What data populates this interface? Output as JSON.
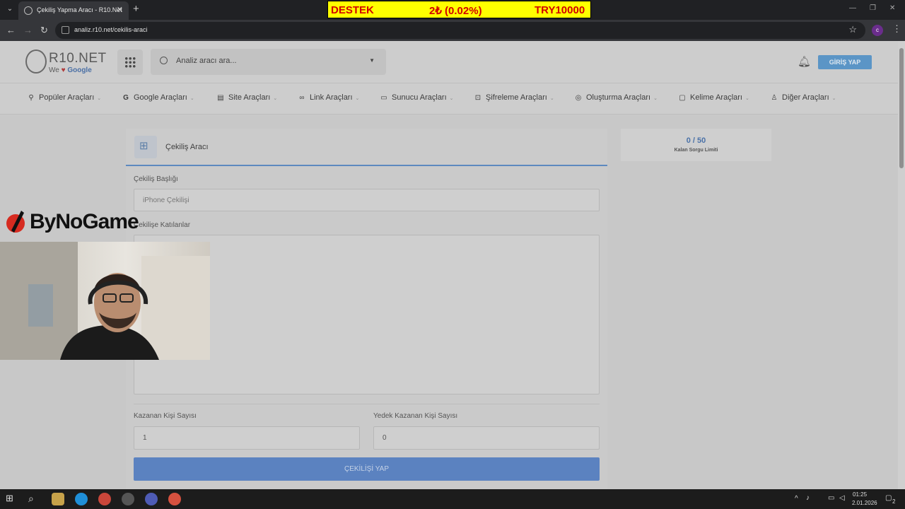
{
  "browser": {
    "tab_title": "Çekiliş Yapma Aracı - R10.Net",
    "url": "analiz.r10.net/cekilis-araci",
    "profile_initial": "c"
  },
  "donation_banner": {
    "label": "DESTEK",
    "amount": "2₺ (0.02%)",
    "goal": "TRY10000"
  },
  "header": {
    "logo_text": "R10.NET",
    "logo_sub_we": "We",
    "logo_sub_google": "Google",
    "search_placeholder": "Analiz aracı ara...",
    "login_label": "GİRİŞ YAP"
  },
  "tools_menu": [
    {
      "label": "Popüler Araçları",
      "icon": "rocket-icon"
    },
    {
      "label": "Google Araçları",
      "icon": "google-icon"
    },
    {
      "label": "Site Araçları",
      "icon": "browser-icon"
    },
    {
      "label": "Link Araçları",
      "icon": "link-icon"
    },
    {
      "label": "Sunucu Araçları",
      "icon": "server-icon"
    },
    {
      "label": "Şifreleme Araçları",
      "icon": "lock-icon"
    },
    {
      "label": "Oluşturma Araçları",
      "icon": "bulb-icon"
    },
    {
      "label": "Kelime Araçları",
      "icon": "message-icon"
    },
    {
      "label": "Diğer Araçları",
      "icon": "user-icon"
    }
  ],
  "tool_card": {
    "title": "Çekiliş Aracı",
    "title_field_label": "Çekiliş Başlığı",
    "title_field_placeholder": "iPhone Çekilişi",
    "participants_label": "Çekilişe Katılanlar",
    "participants_value": "",
    "winners_label": "Kazanan Kişi Sayısı",
    "winners_value": "1",
    "backup_label": "Yedek Kazanan Kişi Sayısı",
    "backup_value": "0",
    "submit_label": "ÇEKİLİŞİ YAP"
  },
  "limit": {
    "used": "0",
    "separator": "/",
    "total": "50",
    "label": "Kalan Sorgu Limiti"
  },
  "overlay": {
    "sponsor_brand": "ByNoGame"
  },
  "taskbar": {
    "time": "01:25",
    "date": "2.01.2026",
    "notifications": "2"
  }
}
